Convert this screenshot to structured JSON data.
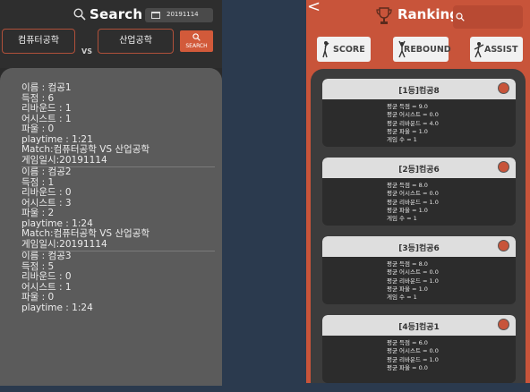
{
  "search_screen": {
    "title": "Search",
    "date": "20191114",
    "team1": "컴퓨터공학",
    "vs": "VS",
    "team2": "산업공학",
    "search_button_label": "SEARCH",
    "records": [
      {
        "name": "이름 : 컴공1",
        "score": "득점 : 6",
        "rebound": "리바운드 : 1",
        "assist": "어시스트 : 1",
        "foul": "파울 : 0",
        "playtime": "playtime : 1:21",
        "match": "Match:컴퓨터공학 VS 산업공학",
        "date": "게임일시:20191114"
      },
      {
        "name": "이름 : 컴공2",
        "score": "득점 : 1",
        "rebound": "리바운드 : 0",
        "assist": "어시스트 : 3",
        "foul": "파울 : 2",
        "playtime": "playtime : 1:24",
        "match": "Match:컴퓨터공학 VS 산업공학",
        "date": "게임일시:20191114"
      },
      {
        "name": "이름 : 컴공3",
        "score": "득점 : 5",
        "rebound": "리바운드 : 0",
        "assist": "어시스트 : 1",
        "foul": "파울 : 0",
        "playtime": "playtime : 1:24",
        "match": "",
        "date": ""
      }
    ]
  },
  "ranking_screen": {
    "back": "<",
    "title": "Ranking",
    "buttons": {
      "score": "SCORE",
      "rebound": "REBOUND",
      "assist": "ASSIST"
    },
    "cards": [
      {
        "title": "[1등]컴공8",
        "lines": [
          "평균 득점 = 9.0",
          "평균 어시스트 = 0.0",
          "평균 리바운드 = 4.0",
          "평균 파울 = 1.0",
          "게임 수 = 1"
        ]
      },
      {
        "title": "[2등]컴공6",
        "lines": [
          "평균 득점 = 8.0",
          "평균 어시스트 = 0.0",
          "평균 리바운드 = 1.0",
          "평균 파울 = 1.0",
          "게임 수 = 1"
        ]
      },
      {
        "title": "[3등]컴공6",
        "lines": [
          "평균 득점 = 8.0",
          "평균 어시스트 = 0.0",
          "평균 리바운드 = 1.0",
          "평균 파울 = 1.0",
          "게임 수 = 1"
        ]
      },
      {
        "title": "[4등]컴공1",
        "lines": [
          "평균 득점 = 6.0",
          "평균 어시스트 = 0.0",
          "평균 리바운드 = 1.0",
          "평균 파울 = 0.0",
          ""
        ]
      }
    ]
  },
  "colors": {
    "accent": "#c8543a",
    "dark_bg": "#2a2a2a",
    "panel_gray": "#5b5b5b",
    "card_dark": "#2c2c2c"
  },
  "icons": [
    "search-icon",
    "calendar-icon",
    "trophy-icon",
    "basketball-player-icon"
  ]
}
